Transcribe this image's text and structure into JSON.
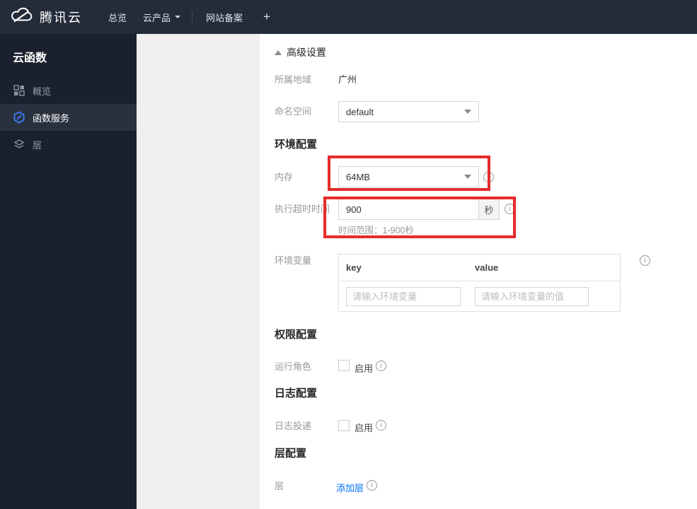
{
  "topbar": {
    "brand": "腾讯云",
    "nav": [
      {
        "label": "总览"
      },
      {
        "label": "云产品"
      },
      {
        "label": "网站备案"
      },
      {
        "label": "+"
      }
    ]
  },
  "sidebar": {
    "title": "云函数",
    "items": [
      {
        "label": "概览"
      },
      {
        "label": "函数服务"
      },
      {
        "label": "层"
      }
    ]
  },
  "content": {
    "advanced_settings_label": "高级设置",
    "region": {
      "label": "所属地域",
      "value": "广州"
    },
    "namespace": {
      "label": "命名空间",
      "value": "default"
    },
    "env_section_title": "环境配置",
    "memory": {
      "label": "内存",
      "value": "64MB"
    },
    "timeout": {
      "label": "执行超时时间",
      "value": "900",
      "unit": "秒",
      "hint": "时间范围：1-900秒"
    },
    "env_vars": {
      "label": "环境变量",
      "key_header": "key",
      "value_header": "value",
      "key_placeholder": "请输入环境变量",
      "value_placeholder": "请输入环境变量的值"
    },
    "permission_section_title": "权限配置",
    "run_role": {
      "label": "运行角色",
      "enable_label": "启用"
    },
    "log_section_title": "日志配置",
    "log_delivery": {
      "label": "日志投递",
      "enable_label": "启用"
    },
    "layer_section_title": "层配置",
    "layer": {
      "label": "层",
      "add_link": "添加层"
    }
  },
  "colors": {
    "annotation_red": "#e62b2b",
    "link_blue": "#006eff",
    "active_icon_blue": "#3d7eff",
    "topbar_bg": "#242b39",
    "sidebar_bg": "#1a202d"
  }
}
